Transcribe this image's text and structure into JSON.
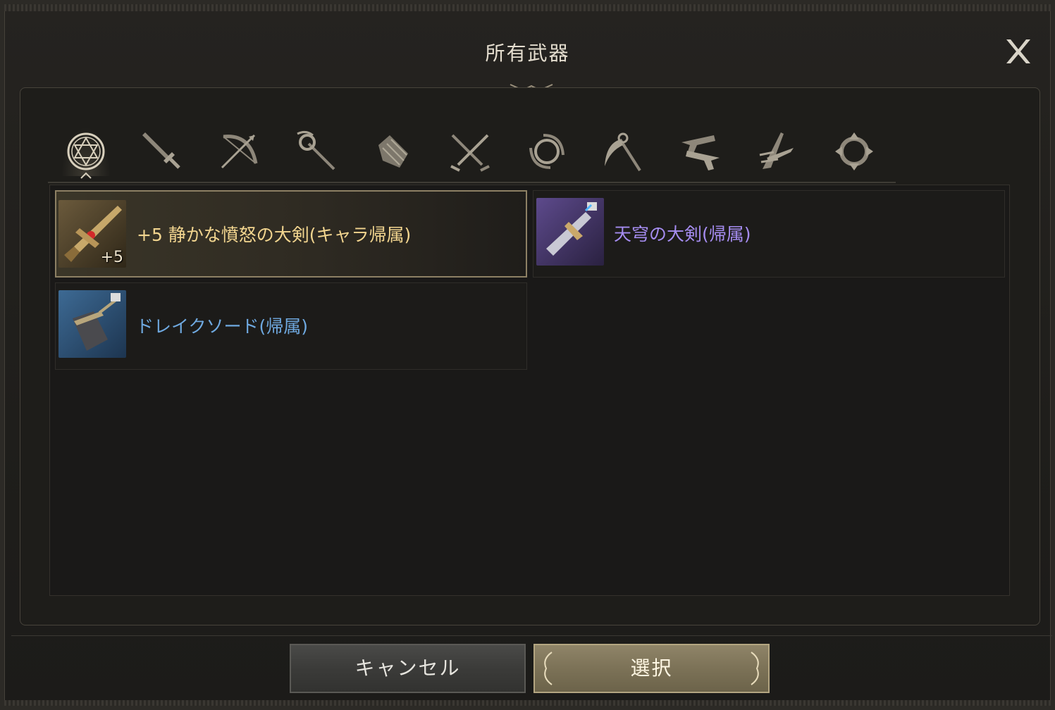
{
  "dialog": {
    "title": "所有武器",
    "close_label": "X"
  },
  "tabs": [
    {
      "icon": "hexagram-icon",
      "active": true
    },
    {
      "icon": "sword-icon",
      "active": false
    },
    {
      "icon": "bow-icon",
      "active": false
    },
    {
      "icon": "staff-icon",
      "active": false
    },
    {
      "icon": "gauntlet-icon",
      "active": false
    },
    {
      "icon": "dual-blades-icon",
      "active": false
    },
    {
      "icon": "orb-icon",
      "active": false
    },
    {
      "icon": "scythe-icon",
      "active": false
    },
    {
      "icon": "dual-pistols-icon",
      "active": false
    },
    {
      "icon": "claw-blade-icon",
      "active": false
    },
    {
      "icon": "chakram-icon",
      "active": false
    }
  ],
  "weapons": [
    {
      "name": "+5 静かな憤怒の大剣(キャラ帰属)",
      "enhance": "+5",
      "grade_color": "#f2d58f",
      "selected": true
    },
    {
      "name": "天穹の大剣(帰属)",
      "enhance": "",
      "grade_color": "#a58cf0",
      "selected": false
    },
    {
      "name": "ドレイクソード(帰属)",
      "enhance": "",
      "grade_color": "#6fa9e0",
      "selected": false
    }
  ],
  "buttons": {
    "cancel": "キャンセル",
    "select": "選択"
  }
}
